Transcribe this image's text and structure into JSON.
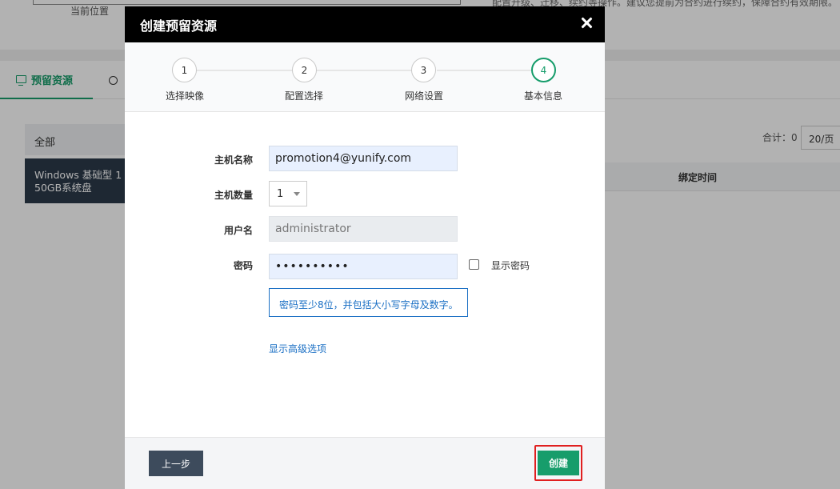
{
  "background": {
    "current_location": "当前位置",
    "top_note": "配置升级、迁移、续约等操作。建议您提前为合约进行续约，保障合约有效期限。",
    "tabs": [
      {
        "label": "预留资源",
        "icon": "monitor-icon"
      },
      {
        "label": "",
        "icon": "clock-icon"
      }
    ],
    "categories": [
      "全部",
      "Windows  基础型  1",
      "50GB系统盘"
    ],
    "total": "合计：0",
    "page_size": "20/页",
    "table_header": "绑定时间"
  },
  "modal": {
    "title": "创建预留资源",
    "close_icon": "close-icon",
    "steps": [
      {
        "number": "1",
        "label": "选择映像"
      },
      {
        "number": "2",
        "label": "配置选择"
      },
      {
        "number": "3",
        "label": "网络设置"
      },
      {
        "number": "4",
        "label": "基本信息"
      }
    ],
    "active_step": 4,
    "form": {
      "host_name_label": "主机名称",
      "host_name_value": "promotion4@yunify.com",
      "host_count_label": "主机数量",
      "host_count_value": "1",
      "username_label": "用户名",
      "username_value": "administrator",
      "password_label": "密码",
      "password_value": "••••••••••",
      "show_password_label": "显示密码",
      "password_hint": "密码至少8位，并包括大小写字母及数字。",
      "advanced_link": "显示高级选项"
    },
    "footer": {
      "prev_label": "上一步",
      "create_label": "创建"
    }
  },
  "colors": {
    "accent": "#179d6b",
    "link": "#1a6fc4",
    "header": "#000000",
    "highlight": "#e02020"
  }
}
